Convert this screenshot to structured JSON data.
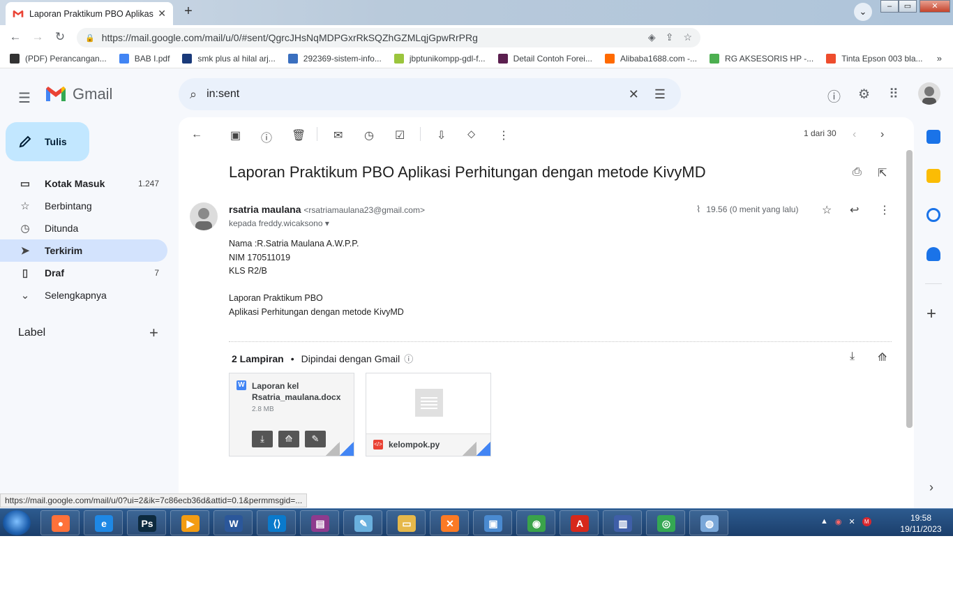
{
  "browser": {
    "tab_title": "Laporan Praktikum PBO Aplikasi",
    "url": "https://mail.google.com/mail/u/0/#sent/QgrcJHsNqMDPGxrRkSQZhGZMLqjGpwRrPRg",
    "bookmarks": [
      {
        "label": "(PDF) Perancangan...",
        "icon": "researchgate-icon",
        "color": "#333333"
      },
      {
        "label": "BAB I.pdf",
        "icon": "file-icon",
        "color": "#4285f4"
      },
      {
        "label": "smk plus al hilal arj...",
        "icon": "school-icon",
        "color": "#1a3a7a"
      },
      {
        "label": "292369-sistem-info...",
        "icon": "network-icon",
        "color": "#3a6fbf"
      },
      {
        "label": "jbptunikompp-gdl-f...",
        "icon": "gdl-icon",
        "color": "#9bc53d"
      },
      {
        "label": "Detail Contoh Forei...",
        "icon": "ckt-icon",
        "color": "#5b1f4f"
      },
      {
        "label": "Alibaba1688.com -...",
        "icon": "alibaba-icon",
        "color": "#ff6a00"
      },
      {
        "label": "RG AKSESORIS HP -...",
        "icon": "store-icon",
        "color": "#4caf50"
      },
      {
        "label": "Tinta Epson 003 bla...",
        "icon": "shopee-icon",
        "color": "#ee4d2d"
      }
    ],
    "status_url": "https://mail.google.com/mail/u/0?ui=2&ik=7c86ecb36d&attid=0.1&permmsgid=..."
  },
  "gmail": {
    "brand": "Gmail",
    "search_query": "in:sent",
    "compose_label": "Tulis",
    "nav": [
      {
        "label": "Kotak Masuk",
        "count": "1.247",
        "icon": "inbox-icon",
        "glyph": "▭",
        "bold": true
      },
      {
        "label": "Berbintang",
        "count": "",
        "icon": "star-icon",
        "glyph": "☆",
        "bold": false
      },
      {
        "label": "Ditunda",
        "count": "",
        "icon": "clock-icon",
        "glyph": "◷",
        "bold": false
      },
      {
        "label": "Terkirim",
        "count": "",
        "icon": "send-icon",
        "glyph": "➤",
        "bold": true
      },
      {
        "label": "Draf",
        "count": "7",
        "icon": "draft-icon",
        "glyph": "▯",
        "bold": true
      },
      {
        "label": "Selengkapnya",
        "count": "",
        "icon": "chevron-down-icon",
        "glyph": "⌄",
        "bold": false
      }
    ],
    "label_heading": "Label",
    "pager": "1 dari 30",
    "message": {
      "subject": "Laporan Praktikum PBO Aplikasi Perhitungan dengan metode KivyMD",
      "sender_name": "rsatria maulana",
      "sender_email": "<rsatriamaulana23@gmail.com>",
      "to": "kepada freddy.wicaksono",
      "time": "19.56 (0 menit yang lalu)",
      "body_lines": [
        "Nama :R.Satria Maulana A.W.P.P.",
        "NIM 170511019",
        "KLS R2/B",
        "",
        "Laporan Praktikum PBO",
        "Aplikasi Perhitungan dengan metode KivyMD"
      ]
    },
    "attachments": {
      "count_label": "2 Lampiran",
      "scan_label": "Dipindai dengan Gmail",
      "items": [
        {
          "name_line1": "Laporan kel",
          "name_line2": "Rsatria_maulana.docx",
          "size": "2.8 MB"
        },
        {
          "name": "kelompok.py"
        }
      ]
    }
  },
  "taskbar": {
    "time": "19:58",
    "date": "19/11/2023",
    "apps": [
      {
        "name": "firefox-icon",
        "glyph": "●",
        "color": "#ff7139"
      },
      {
        "name": "ie-icon",
        "glyph": "e",
        "color": "#1e88e5"
      },
      {
        "name": "photoshop-icon",
        "glyph": "Ps",
        "color": "#0d2a3e"
      },
      {
        "name": "media-player-icon",
        "glyph": "▶",
        "color": "#f39c12"
      },
      {
        "name": "word-icon",
        "glyph": "W",
        "color": "#2b579a"
      },
      {
        "name": "vscode-icon",
        "glyph": "⟨⟩",
        "color": "#0a7acc"
      },
      {
        "name": "winrar-icon",
        "glyph": "▤",
        "color": "#8e3b8e"
      },
      {
        "name": "notepad-icon",
        "glyph": "✎",
        "color": "#6ab0de"
      },
      {
        "name": "explorer-icon",
        "glyph": "▭",
        "color": "#e6b84a"
      },
      {
        "name": "xampp-icon",
        "glyph": "✕",
        "color": "#fb7a24"
      },
      {
        "name": "photos-icon",
        "glyph": "▣",
        "color": "#4a8ad0"
      },
      {
        "name": "idm-icon",
        "glyph": "◉",
        "color": "#3aa34a"
      },
      {
        "name": "acrobat-icon",
        "glyph": "A",
        "color": "#d7281b"
      },
      {
        "name": "tv-icon",
        "glyph": "▥",
        "color": "#3f5fa8"
      },
      {
        "name": "chrome-icon",
        "glyph": "◎",
        "color": "#34a853"
      },
      {
        "name": "paint-icon",
        "glyph": "◍",
        "color": "#7aa7d8"
      }
    ]
  }
}
